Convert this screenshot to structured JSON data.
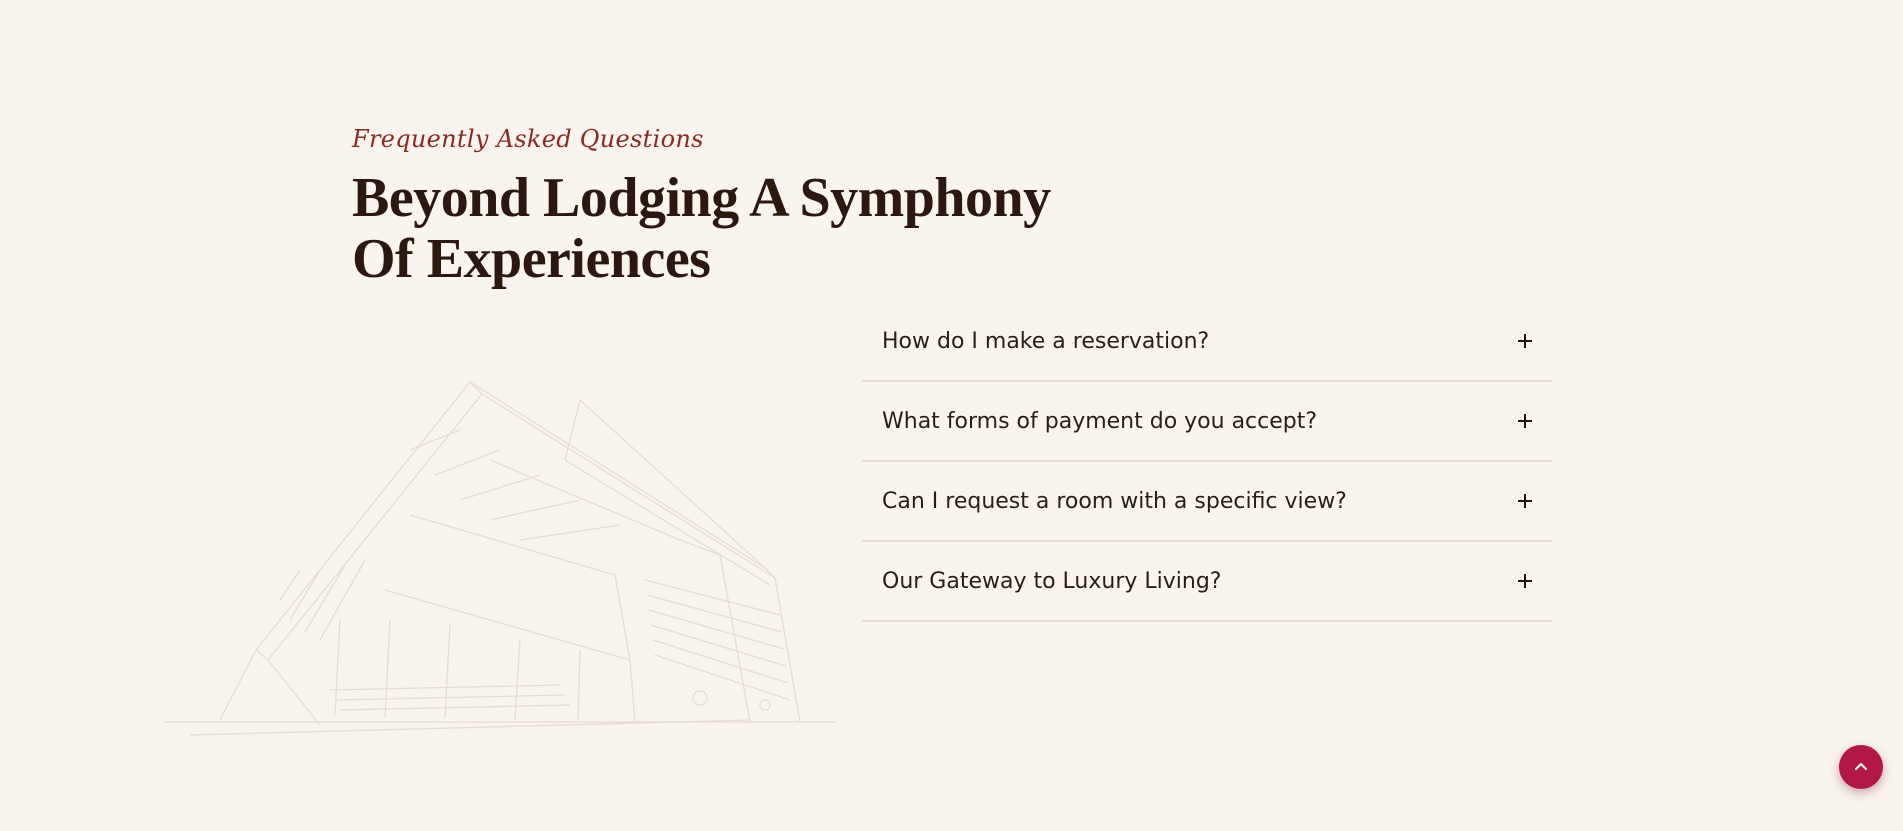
{
  "section": {
    "eyebrow": "Frequently Asked Questions",
    "title_line1": "Beyond Lodging A Symphony",
    "title_line2": "Of Experiences"
  },
  "faq": {
    "items": [
      {
        "question": "How do I make a reservation?"
      },
      {
        "question": "What forms of payment do you accept?"
      },
      {
        "question": "Can I request a room with a specific view?"
      },
      {
        "question": "Our Gateway to Luxury Living?"
      }
    ]
  },
  "icons": {
    "expand": "plus-icon",
    "scroll_top": "chevron-up-icon",
    "illustration": "building-sketch-illustration"
  },
  "colors": {
    "background": "#f9f4ee",
    "eyebrow": "#8a2a20",
    "title": "#2c1810",
    "divider": "#eaddd1",
    "accent": "#b31746"
  }
}
